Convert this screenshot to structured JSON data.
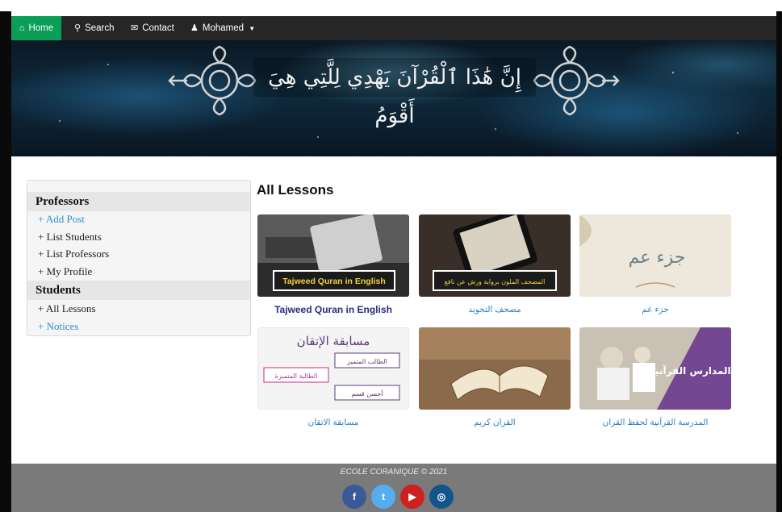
{
  "navbar": {
    "items": [
      {
        "label": "Home",
        "icon": "home-icon"
      },
      {
        "label": "Search",
        "icon": "search-icon"
      },
      {
        "label": "Contact",
        "icon": "envelope-icon"
      },
      {
        "label": "Mohamed",
        "icon": "user-icon"
      }
    ],
    "active_color": "#0a9e58"
  },
  "banner": {
    "verse": "إِنَّ هَٰذَا ٱلْقُرْآنَ يَهْدِي لِلَّتِي هِيَ أَقْوَمُ"
  },
  "sidebar": {
    "sections": [
      {
        "title": "Professors",
        "links": [
          "+ Add Post",
          "+ List Students",
          "+ List Professors",
          "+ My Profile"
        ]
      },
      {
        "title": "Students",
        "links": [
          "+ All Lessons",
          "+ Notices"
        ]
      }
    ]
  },
  "main": {
    "title": "All Lessons",
    "lessons": [
      {
        "caption": "Tajweed Quran in English",
        "overlay": "Tajweed Quran in English"
      },
      {
        "caption": "مصحف التجويد",
        "overlay": "المصحف الملون برواية ورش عن نافع"
      },
      {
        "caption": "جزء عم",
        "overlay": "جزء عم"
      },
      {
        "caption": "مسابقة الاتقان",
        "overlay": "مسابقة الإتقان",
        "sub_labels": [
          "الطالب المتميز",
          "الطالبة المتميزة",
          "أحسن قسم"
        ]
      },
      {
        "caption": "القران كريم",
        "overlay": ""
      },
      {
        "caption": "المدرسة القرآنية لحفظ القران",
        "overlay": "فتح المدارس القرآنية"
      }
    ]
  },
  "footer": {
    "text": "ECOLE CORANIQUE © 2021",
    "social": [
      {
        "icon": "facebook-icon",
        "glyph": "f",
        "color": "#3b5998"
      },
      {
        "icon": "twitter-icon",
        "glyph": "t",
        "color": "#55acee"
      },
      {
        "icon": "youtube-icon",
        "glyph": "▶",
        "color": "#cd201f"
      },
      {
        "icon": "instagram-icon",
        "glyph": "◎",
        "color": "#125688"
      }
    ]
  }
}
